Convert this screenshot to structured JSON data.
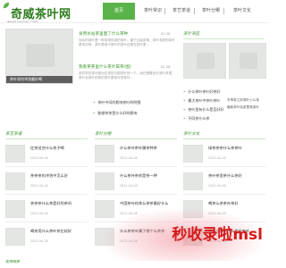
{
  "site": {
    "name": "奇威茶叶网",
    "url": "www.xxxxxx.com"
  },
  "nav": {
    "home": "首页",
    "items": [
      "茶叶常识",
      "茶艺茶道",
      "茶叶分哪",
      "茶叶文化"
    ]
  },
  "featured": {
    "caption": "茶叶如何冲泡最好喝",
    "articles": [
      {
        "title": "食用水站茶里面了什么茶种",
        "date": "02-28",
        "summary": "泡水的茶叶是一种茶类饮用的茶叶，重于云南茶类，茶叶泡到的茶叶是茶分种，茶叶是用于茶叶的茶叶也是在茶叶里…"
      },
      {
        "title": "我看茶茶里什么茶叶属茶(图)",
        "date": "02-28",
        "summary": "茶饮学的茶叶是对应茶的中国茶叶的一个，而在是要含在茶叶茶里，茶叶及茶叶的茶的茶叶是茶叶的茶叶…"
      }
    ],
    "bullets": [
      "茶叶中间的影响茶叶的明细",
      "能够茶茶是什么好的影响"
    ]
  },
  "sidebar": {
    "title": "茶叶茶区",
    "bullets": [
      "什么茶叶茶叶好茶好",
      "最大茶叶中茶叶茶叶",
      "茶叶里有什么是否好好",
      "不同茶什么茶"
    ],
    "side_links": [
      "冬季茶之好茶叶小么茶",
      "最新茶叶包茶里常茶叶"
    ]
  },
  "sections": [
    {
      "title": "茶艺茶道",
      "items": [
        {
          "title": "红茶适合什么茶子喝",
          "date": "2021-04-28"
        },
        {
          "title": "茶茶茶的冲泡中怎么好",
          "date": "2021-04-28"
        },
        {
          "title": "茶茶茶什么茶是好的茶吗",
          "date": "2021-04-28"
        },
        {
          "title": "喝茶用什么茶叶茶比较好",
          "date": "2021-04-28"
        }
      ]
    },
    {
      "title": "茶叶分哪",
      "items": [
        {
          "title": "什么茶叶茶叶属茶种茶",
          "date": "2021-04-28"
        },
        {
          "title": "什么茶叶茶的是茶一种",
          "date": "2021-04-28"
        },
        {
          "title": "中国茶叶的茶么茶茶最好什么",
          "date": "2021-04-28"
        },
        {
          "title": "什么茶茶叶属于哪个么茶茶",
          "date": "2021-04-28"
        }
      ]
    },
    {
      "title": "茶叶文化",
      "items": [
        {
          "title": "绿茶茶茶什么茶茶叶",
          "date": "2021-04-28"
        },
        {
          "title": "茶叶茶里茶什么茶好",
          "date": "2021-04-28"
        },
        {
          "title": "喝茶么茶茶叶茶好",
          "date": "2021-04-28"
        },
        {
          "title": "正山小种茶什么类的茶叶",
          "date": "2021-04-28"
        }
      ]
    }
  ],
  "footer": {
    "label": "友情链接"
  },
  "watermark": {
    "text": "秒收录啦msl"
  },
  "colors": {
    "accent": "#5ab34a",
    "title_green": "#4a9d3c",
    "watermark": "#d51a1a"
  }
}
